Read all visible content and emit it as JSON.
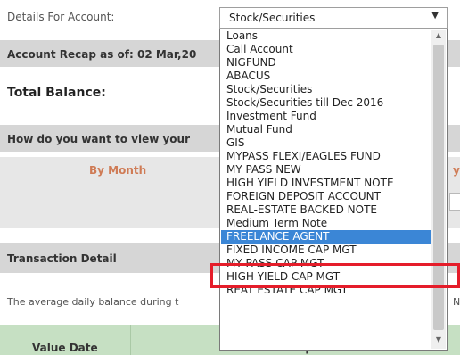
{
  "details_label": "Details For Account:",
  "select": {
    "value": "Stock/Securities"
  },
  "recap_label": "Account Recap as of: 02 Mar,20",
  "total_balance_label": "Total Balance:",
  "view_label": "How do you want to view your",
  "tab_month": "By Month",
  "tab_right": "y",
  "transaction_detail": "Transaction Detail",
  "average_text": "The average daily balance during t",
  "avg_right_fragment": "N",
  "table_headers": {
    "value_date": "Value Date",
    "description": "Description"
  },
  "dropdown": {
    "options": [
      "Loans",
      "Call Account",
      "NIGFUND",
      "ABACUS",
      "Stock/Securities",
      "Stock/Securities till Dec 2016",
      "Investment Fund",
      "Mutual Fund",
      "GIS",
      "MYPASS FLEXI/EAGLES FUND",
      "MY PASS NEW",
      "HIGH YIELD INVESTMENT NOTE",
      "FOREIGN DEPOSIT ACCOUNT",
      "REAL-ESTATE BACKED NOTE",
      "Medium Term Note",
      "FREELANCE AGENT",
      "FIXED INCOME CAP MGT",
      "MY PASS CAP MGT",
      "HIGH YIELD CAP MGT",
      "REAT ESTATE CAP MGT"
    ],
    "selected": "FREELANCE AGENT"
  },
  "colors": {
    "highlight": "#3b86d6",
    "annotation_border": "#e51d2a",
    "tab_text": "#cf7b55",
    "table_header_bg": "#c6e0c3"
  },
  "icons": {
    "select_arrow": "chevron-down-icon"
  }
}
